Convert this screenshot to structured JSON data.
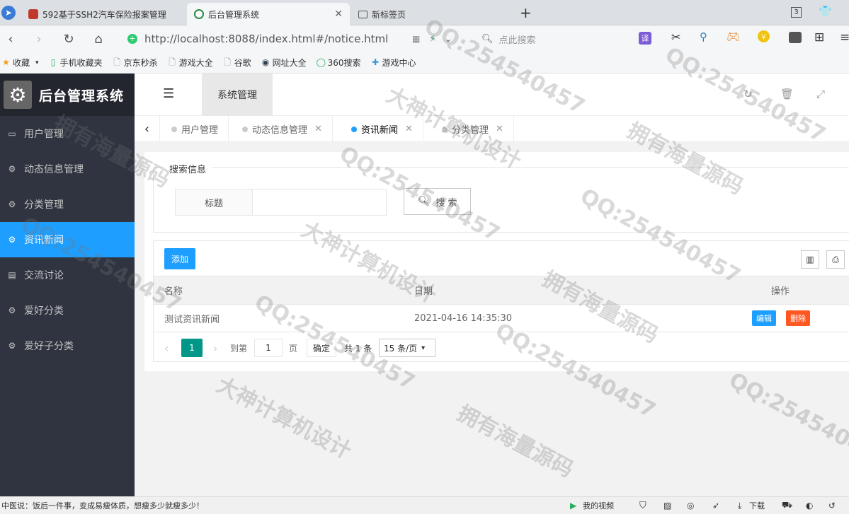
{
  "browser": {
    "tabs": [
      {
        "title": "592基于SSH2汽车保险报案管理"
      },
      {
        "title": "后台管理系统"
      },
      {
        "title": "新标签页"
      }
    ],
    "tab_count": "3",
    "url": "http://localhost:8088/index.html#/notice.html",
    "search_placeholder": "点此搜索",
    "translate_label": "译"
  },
  "bookmarks": [
    {
      "label": "收藏"
    },
    {
      "label": "手机收藏夹"
    },
    {
      "label": "京东秒杀"
    },
    {
      "label": "游戏大全"
    },
    {
      "label": "谷歌"
    },
    {
      "label": "网址大全"
    },
    {
      "label": "360搜索"
    },
    {
      "label": "游戏中心"
    }
  ],
  "app": {
    "title": "后台管理系统",
    "header_tab": "系统管理",
    "menu": [
      {
        "label": "用户管理"
      },
      {
        "label": "动态信息管理"
      },
      {
        "label": "分类管理"
      },
      {
        "label": "资讯新闻"
      },
      {
        "label": "交流讨论"
      },
      {
        "label": "爱好分类"
      },
      {
        "label": "爱好子分类"
      }
    ],
    "page_tabs": [
      {
        "label": "用户管理"
      },
      {
        "label": "动态信息管理"
      },
      {
        "label": "资讯新闻"
      },
      {
        "label": "分类管理"
      }
    ]
  },
  "search_form": {
    "legend": "搜索信息",
    "field_label": "标题",
    "field_value": "",
    "button": "搜 索"
  },
  "table": {
    "add_button": "添加",
    "columns": [
      "名称",
      "日期",
      "操作"
    ],
    "rows": [
      {
        "name": "测试资讯新闻",
        "date": "2021-04-16 14:35:30"
      }
    ],
    "edit_label": "编辑",
    "delete_label": "删除"
  },
  "pager": {
    "current": "1",
    "goto_label": "到第",
    "goto_value": "1",
    "page_unit": "页",
    "confirm": "确定",
    "total": "共 1 条",
    "page_size": "15 条/页"
  },
  "statusbar": {
    "news": "中医说：饭后一件事，变成易瘦体质，想瘦多少就瘦多少！",
    "video": "我的视频",
    "download": "下载"
  },
  "watermarks": [
    "大神计算机设计",
    "QQ:254540457",
    "拥有海量源码"
  ]
}
